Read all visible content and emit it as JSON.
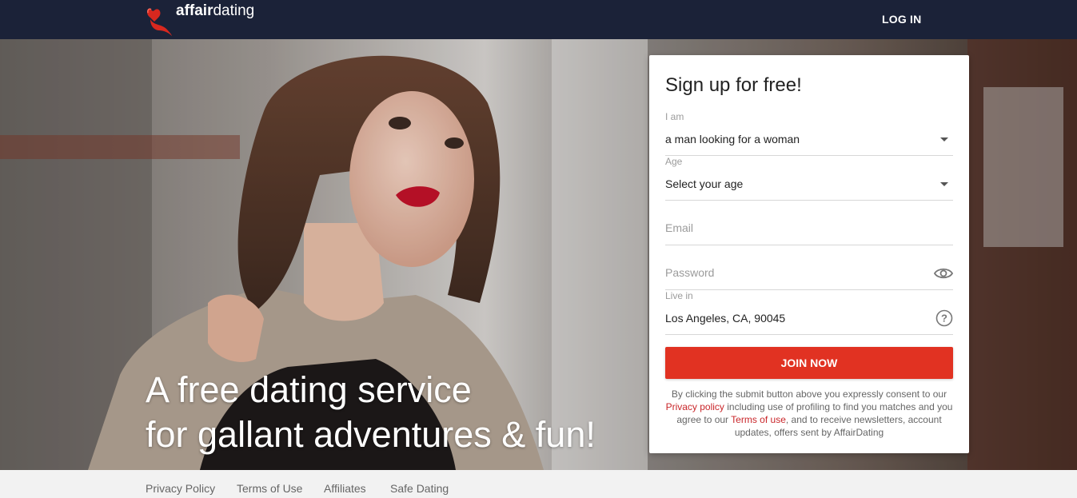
{
  "header": {
    "logo_bold": "affair",
    "logo_light": "dating",
    "login_label": "LOG IN",
    "bg_color": "#1b2238"
  },
  "hero": {
    "headline_line1": "A free dating service",
    "headline_line2": "for gallant adventures & fun!"
  },
  "signup": {
    "title": "Sign up for free!",
    "iam_label": "I am",
    "iam_value": "a man looking for a woman",
    "age_label": "Age",
    "age_value": "Select your age",
    "email_placeholder": "Email",
    "password_placeholder": "Password",
    "livein_label": "Live in",
    "livein_value": "Los Angeles, CA, 90045",
    "join_label": "JOIN NOW",
    "join_color": "#e13222",
    "consent_part1": "By clicking the submit button above you expressly consent to our ",
    "consent_link1": "Privacy policy",
    "consent_part2": " including use of profiling to find you matches and you agree to our ",
    "consent_link2": "Terms of use",
    "consent_part3": ", and to receive newsletters, account updates, offers sent by AffairDating"
  },
  "footer": {
    "links": [
      "Privacy Policy",
      "Terms of Use",
      "Affiliates",
      "Safe Dating"
    ]
  },
  "icons": {
    "logo": "lips-heart-icon",
    "password_toggle": "eye-icon",
    "location_help": "question-circle-icon"
  }
}
